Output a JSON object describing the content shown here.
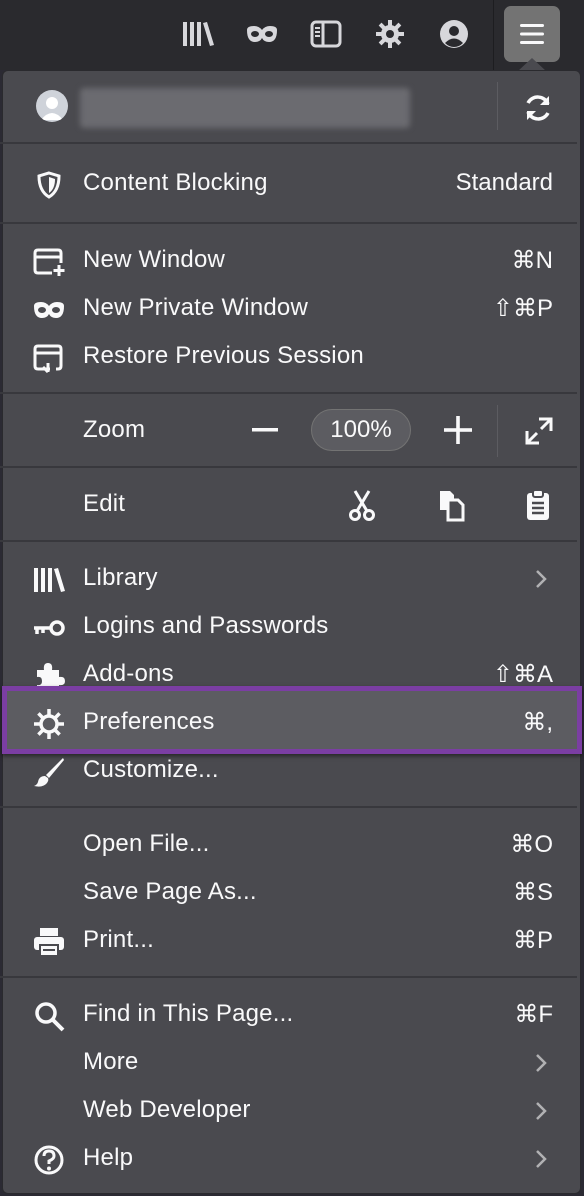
{
  "toolbar": {
    "icons": [
      "library-icon",
      "private-mask-icon",
      "sidebar-icon",
      "gear-icon",
      "account-icon",
      "hamburger-menu-icon"
    ]
  },
  "account": {
    "sync_icon": "sync-icon"
  },
  "content_blocking": {
    "label": "Content Blocking",
    "value": "Standard"
  },
  "windows": [
    {
      "label": "New Window",
      "shortcut": "⌘N"
    },
    {
      "label": "New Private Window",
      "shortcut": "⇧⌘P"
    },
    {
      "label": "Restore Previous Session",
      "shortcut": ""
    }
  ],
  "zoom": {
    "label": "Zoom",
    "minus": "−",
    "value": "100%",
    "plus": "+"
  },
  "edit": {
    "label": "Edit"
  },
  "tools": [
    {
      "label": "Library",
      "shortcut": "",
      "submenu": true
    },
    {
      "label": "Logins and Passwords",
      "shortcut": ""
    },
    {
      "label": "Add-ons",
      "shortcut": "⇧⌘A"
    },
    {
      "label": "Preferences",
      "shortcut": "⌘,"
    },
    {
      "label": "Customize...",
      "shortcut": ""
    }
  ],
  "files": [
    {
      "label": "Open File...",
      "shortcut": "⌘O"
    },
    {
      "label": "Save Page As...",
      "shortcut": "⌘S"
    },
    {
      "label": "Print...",
      "shortcut": "⌘P"
    }
  ],
  "misc": [
    {
      "label": "Find in This Page...",
      "shortcut": "⌘F"
    },
    {
      "label": "More",
      "submenu": true
    },
    {
      "label": "Web Developer",
      "submenu": true
    },
    {
      "label": "Help",
      "submenu": true
    }
  ],
  "colors": {
    "panel": "#4a4a4f",
    "toolbar": "#2a2a2e",
    "highlight_border": "#7b3ea3",
    "text": "#f9f9fa"
  }
}
